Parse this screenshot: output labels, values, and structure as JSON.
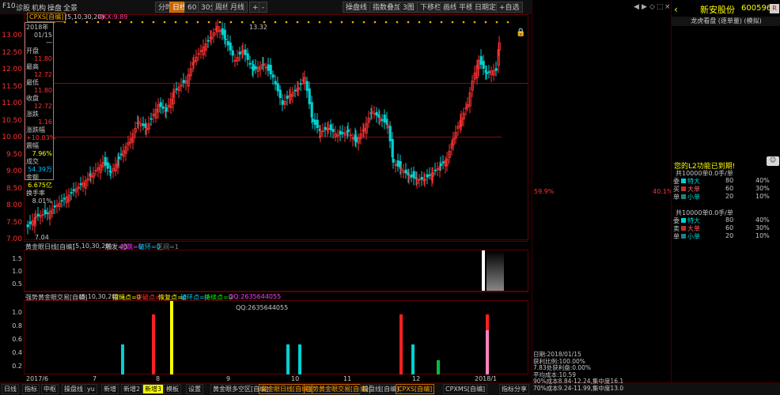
{
  "toolbar": {
    "left_items": [
      "F10",
      "诊股",
      "机构",
      "操盘",
      "全景"
    ],
    "period_buttons": [
      "分时",
      "日线",
      "60",
      "30分",
      "周线",
      "月线"
    ],
    "active_period": "日线",
    "plus_minus": [
      "+",
      "-"
    ],
    "right_buttons": [
      "操盘线",
      "指数叠加",
      "3图",
      "下移栏",
      "画线",
      "平移",
      "日期定位",
      "+自选"
    ],
    "window_controls": [
      "–",
      "□",
      "×"
    ]
  },
  "main_chart": {
    "stock_tag": "CPXS[自编]",
    "ma_label": "(5,10,30,20)",
    "dkx_label": "DKX:9.89",
    "high_label": "13.32",
    "low_label": "7.04",
    "y_ticks": [
      "13.00",
      "12.50",
      "12.00",
      "11.50",
      "11.00",
      "10.50",
      "10.00",
      "9.50",
      "9.00",
      "8.50",
      "8.00",
      "7.50",
      "7.00"
    ]
  },
  "info_box": {
    "year": "2018年",
    "date": "01/15 一",
    "rows": [
      {
        "label": "开盘",
        "value": "11.80"
      },
      {
        "label": "最高",
        "value": "12.72"
      },
      {
        "label": "最低",
        "value": "11.80"
      },
      {
        "label": "收盘",
        "value": "12.72"
      },
      {
        "label": "涨跌",
        "value": "1.16"
      },
      {
        "label": "涨跌幅",
        "value": "+10.03%"
      },
      {
        "label": "震幅",
        "value": "7.96%"
      },
      {
        "label": "成交",
        "value": "54.39万"
      },
      {
        "label": "金额",
        "value": "6.675亿"
      },
      {
        "label": "换手率",
        "value": "8.01%"
      }
    ]
  },
  "sub1": {
    "label": "黄金眼日线[自编]",
    "params": "(5,10,30,20)",
    "text1": "触发=0",
    "text2": "起跳=0",
    "text3": "破环=0",
    "text4": "区间=1",
    "y_ticks": [
      "1.5",
      "1.0",
      "0.5"
    ]
  },
  "sub2": {
    "label": "强势黄金眼交易[自编]",
    "params": "(5,10,30,20)",
    "t1": "摆绳点=0",
    "t2": "突破点=0",
    "t3": "恢复点=0",
    "t4": "破环点=0",
    "t5": "持续点=0",
    "t6": "QQ:2635644055",
    "qq_note": "QQ:2635644055",
    "y_ticks": [
      "1.0",
      "0.8",
      "0.6",
      "0.4",
      "0.2"
    ]
  },
  "x_axis": [
    "2017/6",
    "7",
    "8",
    "9",
    "10",
    "11",
    "12",
    "2018/1"
  ],
  "bottom_bar": {
    "left": [
      "日线",
      "指标",
      "中枢",
      "操盘线",
      "yu",
      "新增",
      "新增2",
      "新增3",
      "模板",
      "设置"
    ],
    "tabs": [
      "黄金眼多空区[自编]",
      "黄金眼日线[自编]",
      "强势黄金眼交易[自编]",
      "操盘线[自编]",
      "CPXS[自编]",
      "CPXMS[自编]"
    ],
    "right": "指标分享"
  },
  "volume_profile": {
    "left_pct": "59.9%",
    "right_pct": "40.1%",
    "stats": [
      "日期:2018/01/15",
      "获利比例:100.00%",
      "7.83处获利盘:0.00%",
      "平均成本:10.59",
      "90%成本8.84-12.24,集中度16.1",
      "70%成本9.24-11.99,集中度13.0"
    ],
    "controls": [
      "◀",
      "▶",
      "◇",
      "⬚",
      "×"
    ]
  },
  "right_panel": {
    "title": "新安股份",
    "code": "600596",
    "subtitle": "龙虎看盘 (逐单量) (模拟)",
    "pie": {
      "cyan_pct": 0.5,
      "red_pct": 0.5
    },
    "l2_warning": "您的L2功能已到期!",
    "flow1": {
      "header": "共10000单0.0手/单",
      "rows": [
        {
          "side": "委",
          "name": "特大",
          "num": "80",
          "pct": "40%"
        },
        {
          "side": "买",
          "name": "大单",
          "num": "60",
          "pct": "30%"
        },
        {
          "side": "单",
          "name": "小单",
          "num": "20",
          "pct": "10%"
        }
      ]
    },
    "flow2": {
      "header": "共10000单0.0手/单",
      "rows": [
        {
          "side": "委",
          "name": "特大",
          "num": "80",
          "pct": "40%"
        },
        {
          "side": "卖",
          "name": "大单",
          "num": "60",
          "pct": "30%"
        },
        {
          "side": "单",
          "name": "小单",
          "num": "20",
          "pct": "10%"
        }
      ]
    }
  },
  "colors": {
    "up": "#ff3232",
    "down": "#00d2d2",
    "accent": "#c86400",
    "yellow": "#ffff00"
  }
}
